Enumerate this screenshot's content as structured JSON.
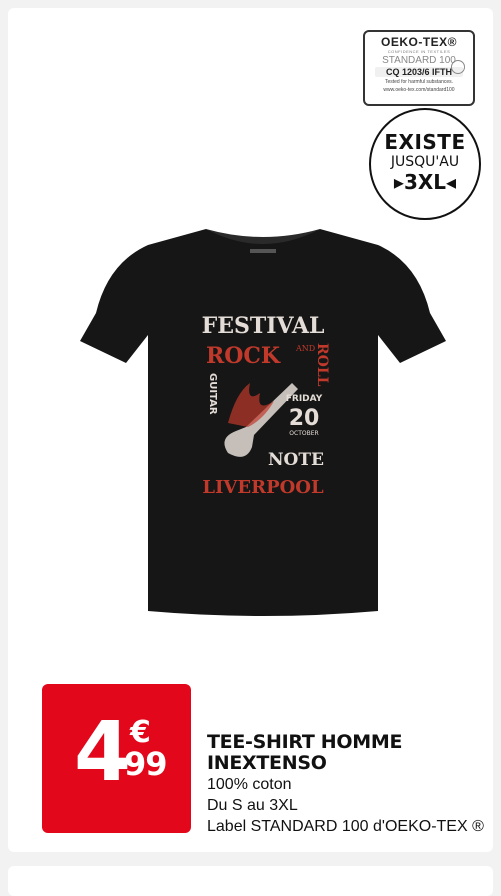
{
  "oeko_label": {
    "brand": "OEKO-TEX®",
    "confidence": "CONFIDENCE IN TEXTILES",
    "standard": "STANDARD 100",
    "code": "CQ 1203/6 IFTH",
    "tested": "Tested for harmful substances.",
    "url": "www.oeko-tex.com/standard100"
  },
  "size_badge": {
    "line1": "EXISTE",
    "line2": "JUSQU'AU",
    "line3": "▸3XL◂"
  },
  "shirt_print": {
    "festival": "FESTIVAL",
    "rock": "ROCK",
    "and": "AND",
    "roll": "ROLL",
    "guitar": "GUITAR",
    "friday": "FRIDAY",
    "day": "20",
    "month": "OCTOBER",
    "note": "NOTE",
    "city": "LIVERPOOL",
    "colors": {
      "shirt": "#161616",
      "print_light": "#e4dcd6",
      "print_red": "#c0392b"
    }
  },
  "price": {
    "euros": "4",
    "currency": "€",
    "cents": "99",
    "color": "#e3071b"
  },
  "product": {
    "title_line1": "TEE-SHIRT HOMME",
    "title_line2": "INEXTENSO",
    "material": "100% coton",
    "sizes": "Du S au 3XL",
    "label": "Label STANDARD 100 d'OEKO-TEX ®"
  }
}
